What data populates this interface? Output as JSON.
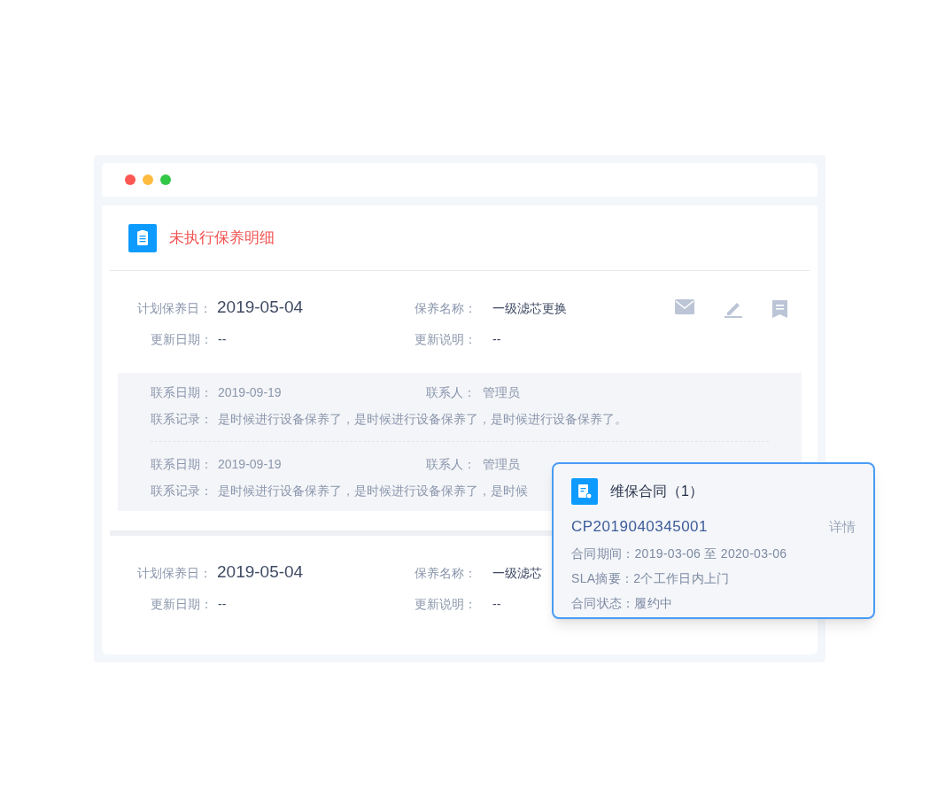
{
  "window": {
    "controls": [
      {
        "color": "#fc5753"
      },
      {
        "color": "#fdbc40"
      },
      {
        "color": "#33c748"
      }
    ]
  },
  "panel": {
    "title": "未执行保养明细"
  },
  "records": [
    {
      "plan_label": "计划保养日：",
      "plan_date": "2019-05-04",
      "name_label": "保养名称：",
      "name": "一级滤芯更换",
      "update_label": "更新日期：",
      "update_date": "--",
      "note_label": "更新说明：",
      "note": "--",
      "actions": true,
      "contacts": [
        {
          "date_label": "联系日期：",
          "date": "2019-09-19",
          "person_label": "联系人：",
          "person": "管理员",
          "log_label": "联系记录：",
          "log": "是时候进行设备保养了，是时候进行设备保养了，是时候进行设备保养了。"
        },
        {
          "date_label": "联系日期：",
          "date": "2019-09-19",
          "person_label": "联系人：",
          "person": "管理员",
          "log_label": "联系记录：",
          "log": "是时候进行设备保养了，是时候进行设备保养了，是时候"
        }
      ]
    },
    {
      "plan_label": "计划保养日：",
      "plan_date": "2019-05-04",
      "name_label": "保养名称：",
      "name": "一级滤芯",
      "update_label": "更新日期：",
      "update_date": "--",
      "note_label": "更新说明：",
      "note": "--"
    }
  ],
  "popup": {
    "title": "维保合同（1）",
    "number": "CP2019040345001",
    "link": "详情",
    "lines": [
      "合同期间：2019-03-06 至 2020-03-06",
      "SLA摘要：2个工作日内上门",
      "合同状态：履约中"
    ]
  }
}
